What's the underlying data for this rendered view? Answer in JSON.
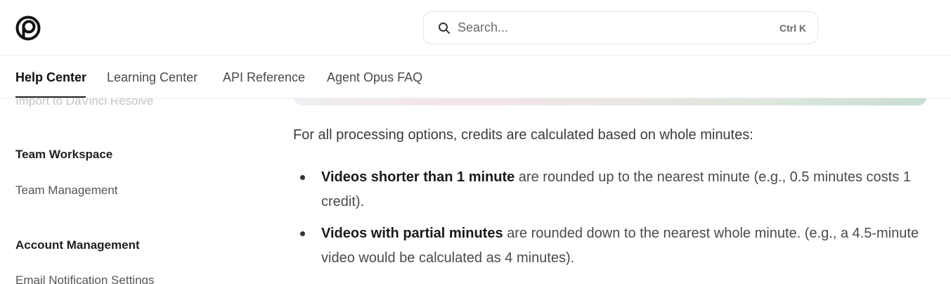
{
  "search": {
    "placeholder": "Search...",
    "shortcut": "Ctrl K"
  },
  "tabs": [
    {
      "label": "Help Center",
      "active": true
    },
    {
      "label": "Learning Center",
      "active": false
    },
    {
      "label": "API Reference",
      "active": false
    },
    {
      "label": "Agent Opus FAQ",
      "active": false
    }
  ],
  "sidebar": {
    "faded_item": "Import to DaVinci Resolve",
    "sections": [
      {
        "heading": "Team Workspace",
        "items": [
          "Team Management"
        ]
      },
      {
        "heading": "Account Management",
        "items": [
          "Email Notification Settings"
        ]
      }
    ]
  },
  "main": {
    "intro": "For all processing options, credits are calculated based on whole minutes:",
    "bullets": [
      {
        "bold": "Videos shorter than 1 minute",
        "text": " are rounded up to the nearest minute (e.g., 0.5 minutes costs 1 credit)."
      },
      {
        "bold": "Videos with partial minutes",
        "text": " are rounded down to the nearest whole minute. (e.g., a 4.5-minute video would be calculated as 4 minutes)."
      }
    ]
  },
  "icons": {
    "logo": "brand-logo-icon",
    "search": "search-icon"
  }
}
